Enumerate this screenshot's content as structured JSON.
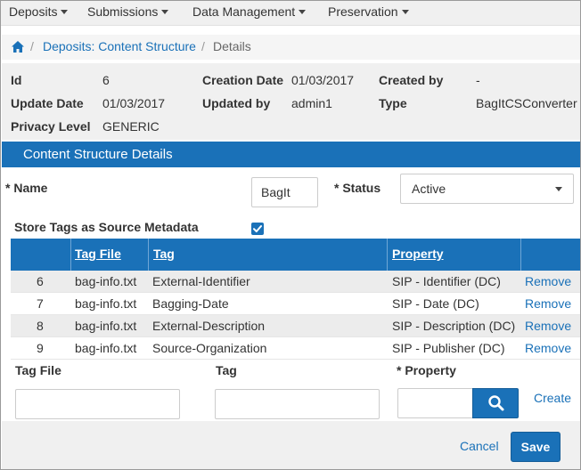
{
  "menu": [
    {
      "label": "Deposits"
    },
    {
      "label": "Submissions"
    },
    {
      "label": "Data Management"
    },
    {
      "label": "Preservation"
    }
  ],
  "breadcrumb": {
    "separator": "/",
    "parent": "Deposits: Content Structure",
    "current": "Details"
  },
  "info": {
    "id_label": "Id",
    "id_value": "6",
    "creation_date_label": "Creation Date",
    "creation_date_value": "01/03/2017",
    "created_by_label": "Created by",
    "created_by_value": "-",
    "update_date_label": "Update Date",
    "update_date_value": "01/03/2017",
    "updated_by_label": "Updated by",
    "updated_by_value": "admin1",
    "type_label": "Type",
    "type_value": "BagItCSConverter",
    "privacy_label": "Privacy Level",
    "privacy_value": "GENERIC"
  },
  "section": {
    "title": "Content Structure Details"
  },
  "form": {
    "name_label": "* Name",
    "name_value": "BagIt",
    "status_label": "* Status",
    "status_value": "Active",
    "store_tags_label": "Store Tags as Source Metadata",
    "store_tags_checked": true
  },
  "table": {
    "columns": [
      "",
      "Tag File",
      "Tag",
      "Property",
      ""
    ],
    "remove_label": "Remove",
    "rows": [
      {
        "num": "6",
        "tag_file": "bag-info.txt",
        "tag": "External-Identifier",
        "property": "SIP - Identifier (DC)"
      },
      {
        "num": "7",
        "tag_file": "bag-info.txt",
        "tag": "Bagging-Date",
        "property": "SIP - Date (DC)"
      },
      {
        "num": "8",
        "tag_file": "bag-info.txt",
        "tag": "External-Description",
        "property": "SIP - Description (DC)"
      },
      {
        "num": "9",
        "tag_file": "bag-info.txt",
        "tag": "Source-Organization",
        "property": "SIP - Publisher (DC)"
      }
    ]
  },
  "add_row": {
    "tag_file_label": "Tag File",
    "tag_label": "Tag",
    "property_label": "* Property",
    "tag_file_value": "",
    "tag_value": "",
    "property_value": "",
    "create_label": "Create"
  },
  "footer": {
    "cancel_label": "Cancel",
    "save_label": "Save"
  },
  "colors": {
    "accent": "#1a71b8",
    "panel": "#f0f0f0",
    "row_alt": "#ececec"
  },
  "icons": [
    "home-icon",
    "chevron-down-icon",
    "search-icon",
    "checkmark-icon"
  ]
}
